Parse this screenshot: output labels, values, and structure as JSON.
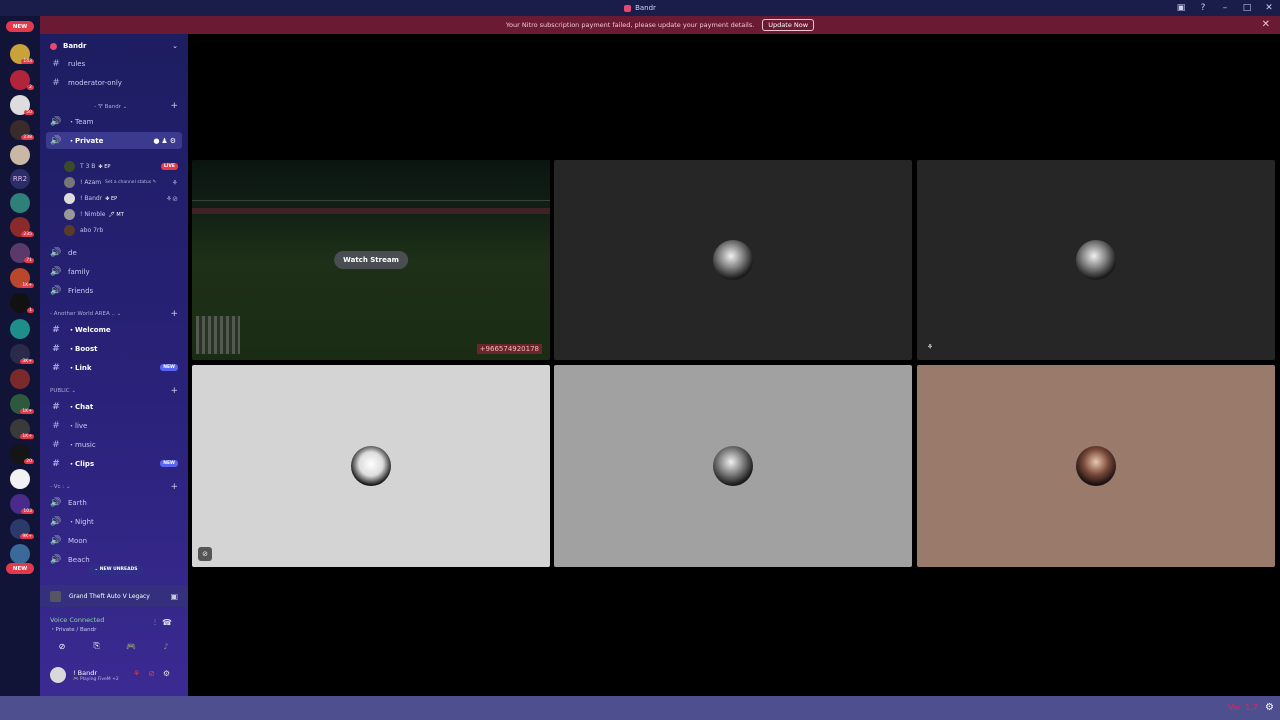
{
  "window": {
    "title": "Bandr"
  },
  "notice": {
    "text": "Your Nitro subscription payment failed, please update your payment details.",
    "button": "Update Now"
  },
  "rail": {
    "new_top": "NEW",
    "new_bottom": "NEW",
    "text_server": "RR2",
    "badges": [
      "143",
      "2",
      "50",
      "238",
      "1",
      "235",
      "71",
      "1K+",
      "1",
      "3K+",
      "1K+",
      "1K+",
      "20",
      "103",
      "9K+",
      "1K+"
    ]
  },
  "server": {
    "name": "Bandr"
  },
  "channels": {
    "rules": "rules",
    "moderator": "moderator-only",
    "cat_bandr": "- 🝖 Bandr ⌄",
    "team": "・Team",
    "private": "・Private",
    "private_status": "Set a channel status ✎",
    "de": "de",
    "family": "family",
    "friends": "Friends",
    "cat_another": "- Another World AREA .. ⌄",
    "welcome": "・Welcome",
    "boost": "・Boost",
    "link": "・Link",
    "cat_public": "PUBLIC ⌄",
    "chat": "・Chat",
    "live": "・live",
    "music": "・music",
    "clips": "・Clips",
    "cat_vc": "- Vc : ⌄",
    "earth": "Earth",
    "night": "・Night",
    "moon": "Moon",
    "beach": "Beach",
    "new_tag": "NEW",
    "new_unreads": "⌄ NEW UNREADS"
  },
  "members": [
    {
      "name": "T 3 B",
      "tag": "✤ EP",
      "status": "LIVE"
    },
    {
      "name": "! Azam",
      "tag": "",
      "status": ""
    },
    {
      "name": "! Bandr",
      "tag": "✤ EP",
      "status": ""
    },
    {
      "name": "! Nimble",
      "tag": "🖊 MT",
      "status": ""
    },
    {
      "name": "abo 7rb",
      "tag": "",
      "status": ""
    }
  ],
  "activity": {
    "game": "Grand Theft Auto V Legacy"
  },
  "voice": {
    "title": "Voice Connected",
    "location": "・Private / Bandr"
  },
  "user": {
    "name": "! Bandr",
    "status": "🎮 Playing FiveM +2"
  },
  "stream": {
    "watch_label": "Watch Stream",
    "overlay_number": "+966574920178"
  },
  "footer": {
    "version": "Ver. 1.7"
  },
  "colors": {
    "accent": "#5865f2",
    "live": "#e23a4a",
    "sidebar_top": "#1d1d61",
    "tile_light": "#d4d4d4",
    "tile_mid": "#a1a1a1",
    "tile_warm": "#9a7b6b",
    "tile_dark": "#262626"
  }
}
